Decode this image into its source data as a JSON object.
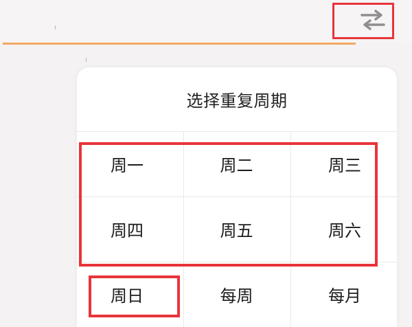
{
  "header": {
    "repeat_icon": "repeat-swap-icon",
    "accent_color": "#f2a866"
  },
  "popover": {
    "title": "选择重复周期",
    "options": [
      "周一",
      "周二",
      "周三",
      "周四",
      "周五",
      "周六",
      "周日",
      "每周",
      "每月"
    ],
    "highlight_color": "#e8343a"
  }
}
